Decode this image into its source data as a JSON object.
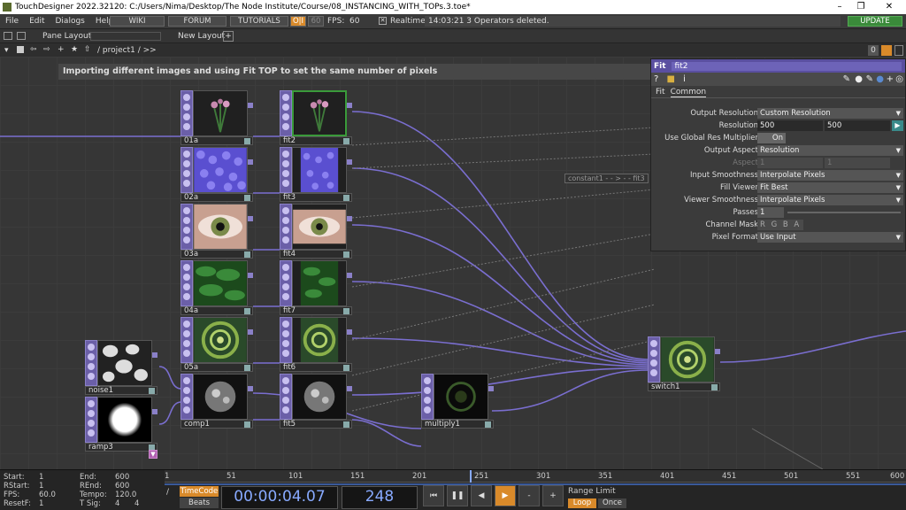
{
  "window": {
    "title": "TouchDesigner 2022.32120: C:/Users/Nima/Desktop/The Node Institute/Course/08_INSTANCING_WITH_TOPs.3.toe*"
  },
  "menu": [
    "File",
    "Edit",
    "Dialogs",
    "Help"
  ],
  "toolbar": {
    "wiki": "WIKI",
    "forum": "FORUM",
    "tutorials": "TUTORIALS",
    "oi": "O|I",
    "fps_cap": "60",
    "fps_label": "FPS:",
    "fps_value": "60",
    "realtime": "Realtime",
    "status": "14:03:21 3 Operators deleted.",
    "update": "UPDATE"
  },
  "pane": {
    "pane_layout": "Pane Layout",
    "new_layout": "New Layout"
  },
  "path": {
    "crumb": "/ project1 / >>",
    "zero": "0"
  },
  "annotation": "Importing different images and using Fit TOP to set the same number of pixels",
  "nodes": {
    "n01a": "01a",
    "fit2": "fit2",
    "n02a": "02a",
    "fit3": "fit3",
    "n03a": "03a",
    "fit4": "fit4",
    "n04a": "04a",
    "fit7": "fit7",
    "n05a": "05a",
    "fit6": "fit6",
    "noise1": "noise1",
    "comp1": "comp1",
    "fit5": "fit5",
    "ramp3": "ramp3",
    "multiply1": "multiply1",
    "switch1": "switch1"
  },
  "wire_label": "constant1 - - > - - fit3",
  "params": {
    "type": "Fit",
    "name": "fit2",
    "tabs": [
      "Fit",
      "Common"
    ],
    "rows": [
      {
        "label": "Output Resolution",
        "value": "Custom Resolution"
      },
      {
        "label": "Resolution",
        "value": "500",
        "value2": "500"
      },
      {
        "label": "Use Global Res Multiplier",
        "value": "On"
      },
      {
        "label": "Output Aspect",
        "value": "Resolution"
      },
      {
        "label": "Aspect",
        "value": "1",
        "value2": "1"
      },
      {
        "label": "Input Smoothness",
        "value": "Interpolate Pixels"
      },
      {
        "label": "Fill Viewer",
        "value": "Fit Best"
      },
      {
        "label": "Viewer Smoothness",
        "value": "Interpolate Pixels"
      },
      {
        "label": "Passes",
        "value": "1"
      },
      {
        "label": "Channel Mask",
        "value": "R G B A"
      },
      {
        "label": "Pixel Format",
        "value": "Use Input"
      }
    ]
  },
  "timeline": {
    "start": "1",
    "rstart": "1",
    "fps": "60.0",
    "resetf": "1",
    "end": "600",
    "rend": "600",
    "tempo": "120.0",
    "tsig_a": "4",
    "tsig_b": "4",
    "labels": {
      "start": "Start:",
      "rstart": "RStart:",
      "fps": "FPS:",
      "resetf": "ResetF:",
      "end": "End:",
      "rend": "REnd:",
      "tempo": "Tempo:",
      "tsig": "T Sig:"
    },
    "timecode": "TimeCode",
    "beats": "Beats",
    "time": "00:00:04.07",
    "frame": "248",
    "ticks": [
      "1",
      "51",
      "101",
      "151",
      "201",
      "251",
      "301",
      "351",
      "401",
      "451",
      "501",
      "551",
      "600"
    ],
    "range_limit": "Range Limit",
    "loop": "Loop",
    "once": "Once"
  }
}
